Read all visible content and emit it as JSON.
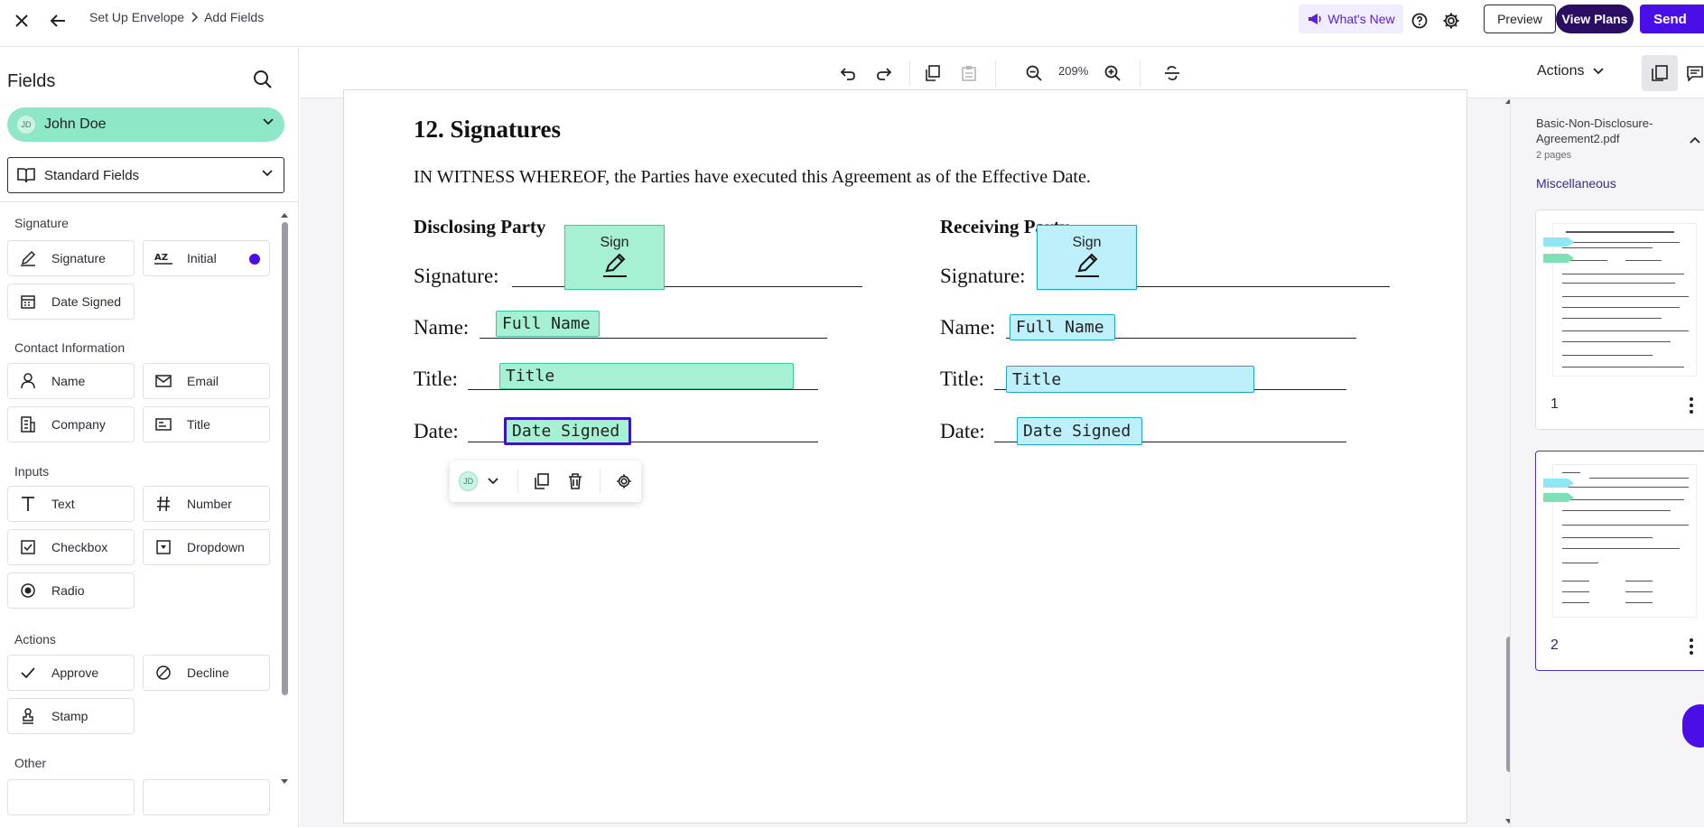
{
  "header": {
    "breadcrumb": [
      "Set Up Envelope",
      "Add Fields"
    ],
    "whats_new": "What's New",
    "preview": "Preview",
    "view_plans": "View Plans",
    "send": "Send"
  },
  "sidebar": {
    "title": "Fields",
    "recipient": {
      "initials": "JD",
      "name": "John Doe"
    },
    "field_set": "Standard Fields",
    "sections": {
      "signature": {
        "label": "Signature",
        "items": [
          "Signature",
          "Initial",
          "Date Signed"
        ]
      },
      "contact": {
        "label": "Contact Information",
        "items": [
          "Name",
          "Email",
          "Company",
          "Title"
        ]
      },
      "inputs": {
        "label": "Inputs",
        "items": [
          "Text",
          "Number",
          "Checkbox",
          "Dropdown",
          "Radio"
        ]
      },
      "actions": {
        "label": "Actions",
        "items": [
          "Approve",
          "Decline",
          "Stamp"
        ]
      },
      "other": {
        "label": "Other"
      }
    }
  },
  "toolbar": {
    "zoom": "209%",
    "actions": "Actions"
  },
  "document": {
    "heading": "12. Signatures",
    "witness": "IN WITNESS WHEREOF, the Parties have executed this Agreement as of the Effective Date.",
    "disclosing_party": "Disclosing Party",
    "receiving_party": "Receiving Party",
    "labels": {
      "signature": "Signature:",
      "name": "Name:",
      "title": "Title:",
      "date": "Date:"
    },
    "fields": {
      "sign": "Sign",
      "full_name": "Full Name",
      "title": "Title",
      "date_signed": "Date Signed"
    },
    "popover_initials": "JD"
  },
  "right_panel": {
    "file_name": "Basic-Non-Disclosure-Agreement2.pdf",
    "pages": "2 pages",
    "folder": "Miscellaneous",
    "thumbnails": [
      "1",
      "2"
    ]
  },
  "colors": {
    "accent": "#4a0ee6",
    "signer1": "#a6f0d3",
    "signer2": "#bdf0fb",
    "selected_border": "#3a17b8"
  }
}
